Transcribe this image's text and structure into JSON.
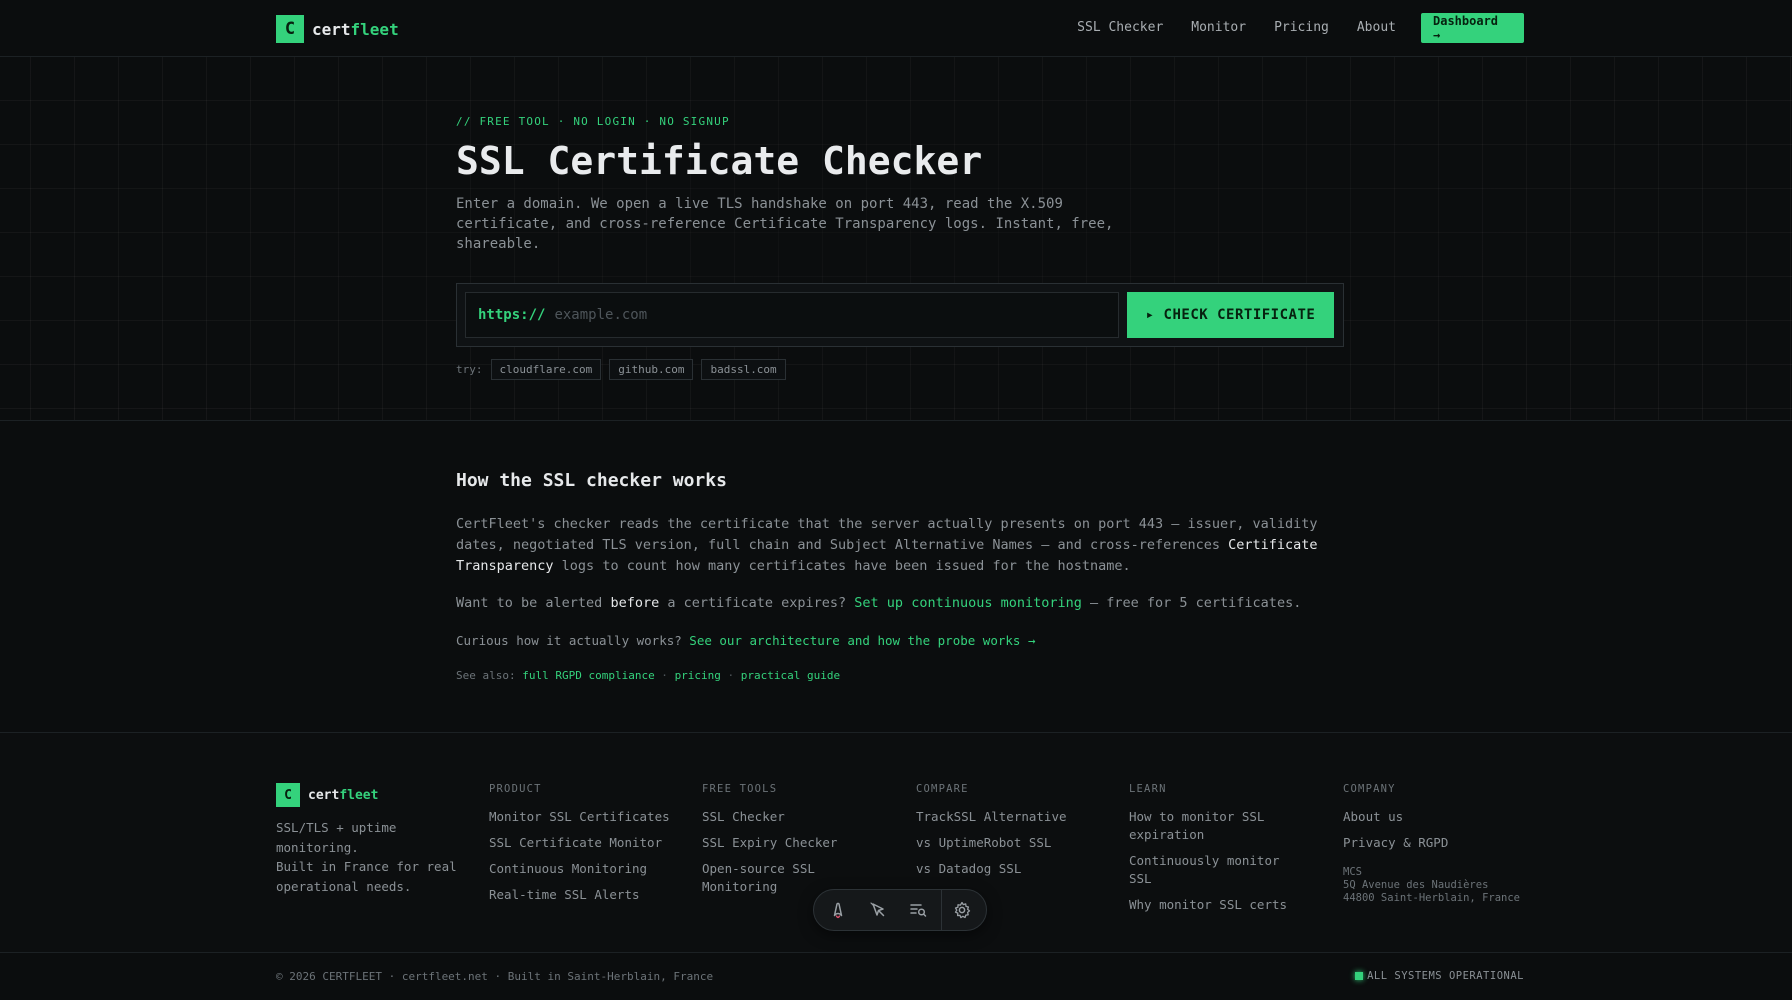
{
  "header": {
    "logo_letter": "C",
    "brand_prefix": "cert",
    "brand_suffix": "fleet",
    "nav": [
      "SSL Checker",
      "Monitor",
      "Pricing",
      "About"
    ],
    "dashboard_label": "Dashboard →"
  },
  "hero": {
    "eyebrow": "// FREE TOOL · NO LOGIN · NO SIGNUP",
    "title": "SSL Certificate Checker",
    "description": "Enter a domain. We open a live TLS handshake on port 443, read the X.509 certificate, and cross-reference Certificate Transparency logs. Instant, free, shareable.",
    "url_prefix": "https://",
    "url_placeholder": "example.com",
    "url_value": "",
    "check_label": "▸ CHECK CERTIFICATE",
    "try_label": "try:",
    "examples": [
      "cloudflare.com",
      "github.com",
      "badssl.com"
    ]
  },
  "content": {
    "title": "How the SSL checker works",
    "p1_a": "CertFleet's checker reads the certificate that the server actually presents on port 443 — issuer, validity dates, negotiated TLS version, full chain and Subject Alternative Names — and cross-references ",
    "p1_hl": "Certificate Transparency",
    "p1_b": " logs to count how many certificates have been issued for the hostname.",
    "p2_a": "Want to be alerted ",
    "p2_hl": "before",
    "p2_b": " a certificate expires? ",
    "p2_link": "Set up continuous monitoring",
    "p2_c": " — free for 5 certificates.",
    "p3_a": "Curious how it actually works? ",
    "p3_link": "See our architecture and how the probe works →",
    "p4_a": "See also: ",
    "p4_links": [
      "full RGPD compliance",
      "pricing",
      "practical guide"
    ],
    "p4_sep": " · "
  },
  "footer": {
    "logo_letter": "C",
    "brand_prefix": "cert",
    "brand_suffix": "fleet",
    "tagline_1": "SSL/TLS + uptime monitoring.",
    "tagline_2": "Built in France for real operational needs.",
    "columns": [
      {
        "head": "PRODUCT",
        "links": [
          "Monitor SSL Certificates",
          "SSL Certificate Monitor",
          "Continuous Monitoring",
          "Real-time SSL Alerts"
        ]
      },
      {
        "head": "FREE TOOLS",
        "links": [
          "SSL Checker",
          "SSL Expiry Checker",
          "Open-source SSL Monitoring"
        ]
      },
      {
        "head": "COMPARE",
        "links": [
          "TrackSSL Alternative",
          "vs UptimeRobot SSL",
          "vs Datadog SSL"
        ]
      },
      {
        "head": "LEARN",
        "links": [
          "How to monitor SSL expiration",
          "Continuously monitor SSL",
          "Why monitor SSL certs"
        ]
      },
      {
        "head": "COMPANY",
        "links": [
          "About us",
          "Privacy & RGPD"
        ]
      }
    ],
    "address": [
      "MCS",
      "5Q Avenue des Naudières",
      "44800 Saint-Herblain, France"
    ],
    "copyright": "© 2026 CERTFLEET · certfleet.net · Built in Saint-Herblain, France",
    "status": "ALL SYSTEMS OPERATIONAL"
  },
  "toolbar": {
    "icons": [
      "astro-icon",
      "cursor-inspect-icon",
      "audit-search-icon",
      "gear-icon"
    ]
  },
  "colors": {
    "accent": "#34d27c",
    "background": "#0b0d0e",
    "text": "#c9cdd0",
    "muted": "#8b9196"
  }
}
